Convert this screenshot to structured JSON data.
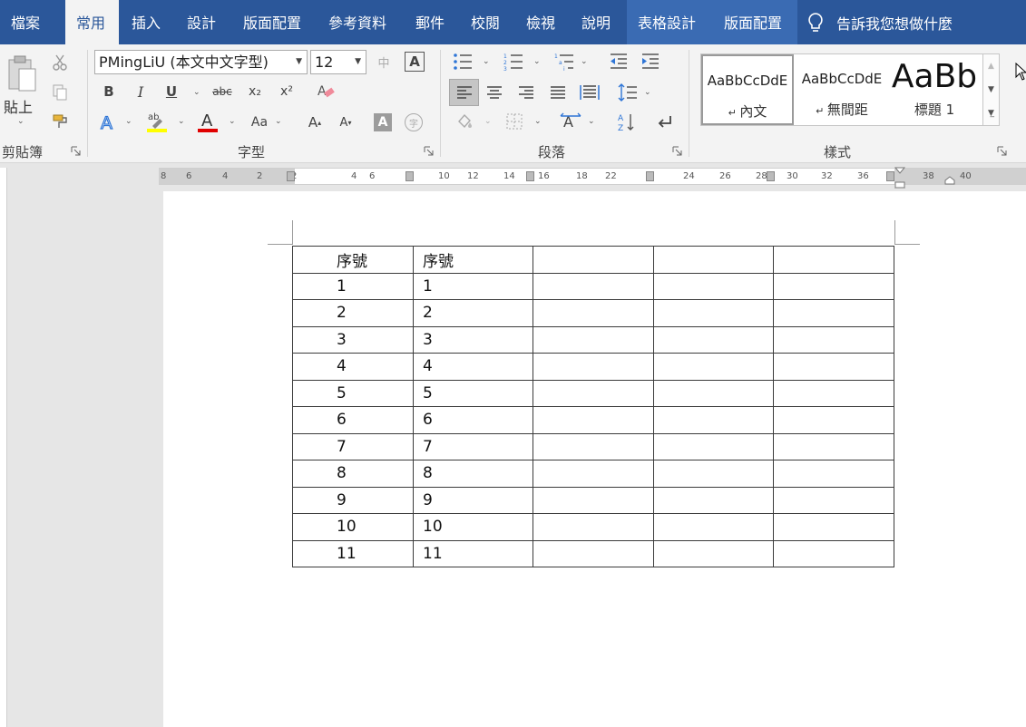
{
  "tabs": [
    {
      "label": "檔案"
    },
    {
      "label": "常用"
    },
    {
      "label": "插入"
    },
    {
      "label": "設計"
    },
    {
      "label": "版面配置"
    },
    {
      "label": "參考資料"
    },
    {
      "label": "郵件"
    },
    {
      "label": "校閱"
    },
    {
      "label": "檢視"
    },
    {
      "label": "說明"
    },
    {
      "label": "表格設計"
    },
    {
      "label": "版面配置"
    }
  ],
  "tell_me": "告訴我您想做什麼",
  "clipboard": {
    "paste_label": "貼上",
    "group_label": "剪貼簿"
  },
  "font": {
    "name": "PMingLiU (本文中文字型)",
    "size": "12",
    "group_label": "字型",
    "bold": "B",
    "italic": "I",
    "underline": "U",
    "strike": "abc",
    "subscript": "x₂",
    "superscript": "x²",
    "change_case": "Aa",
    "grow": "A",
    "shrink": "A",
    "shading": "A",
    "phonetic": "中"
  },
  "paragraph": {
    "group_label": "段落"
  },
  "styles": {
    "group_label": "樣式",
    "items": [
      {
        "sample": "AaBbCcDdE",
        "name": "內文"
      },
      {
        "sample": "AaBbCcDdE",
        "name": "無間距"
      },
      {
        "sample": "AaBb",
        "name": "標題 1"
      }
    ]
  },
  "ruler_ticks": [
    "8",
    "6",
    "4",
    "2",
    "2",
    "4",
    "6",
    "8",
    "10",
    "12",
    "14",
    "16",
    "18",
    "22",
    "24",
    "26",
    "28",
    "30",
    "32",
    "36",
    "38",
    "40"
  ],
  "table": {
    "rows": [
      [
        "序號",
        "序號",
        "",
        "",
        ""
      ],
      [
        "1",
        "1",
        "",
        "",
        ""
      ],
      [
        "2",
        "2",
        "",
        "",
        ""
      ],
      [
        "3",
        "3",
        "",
        "",
        ""
      ],
      [
        "4",
        "4",
        "",
        "",
        ""
      ],
      [
        "5",
        "5",
        "",
        "",
        ""
      ],
      [
        "6",
        "6",
        "",
        "",
        ""
      ],
      [
        "7",
        "7",
        "",
        "",
        ""
      ],
      [
        "8",
        "8",
        "",
        "",
        ""
      ],
      [
        "9",
        "9",
        "",
        "",
        ""
      ],
      [
        "10",
        "10",
        "",
        "",
        ""
      ],
      [
        "11",
        "11",
        "",
        "",
        ""
      ]
    ]
  },
  "colors": {
    "ribbon_blue": "#2b579a",
    "highlight": "#ffff00",
    "font_color": "#e00000"
  }
}
